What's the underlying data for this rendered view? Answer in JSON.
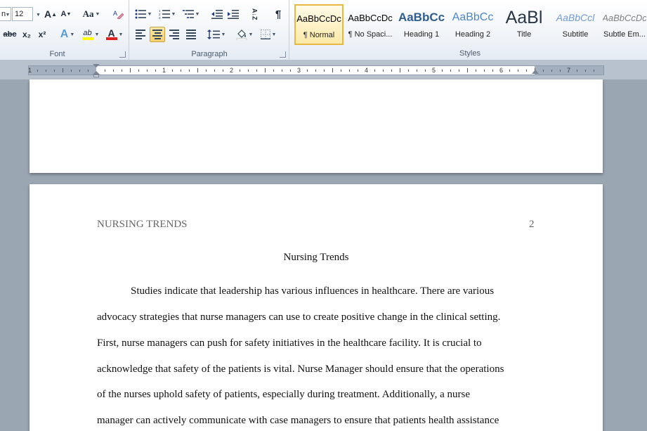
{
  "ribbon": {
    "font": {
      "label": "Font",
      "font_name": "n",
      "font_size": "12",
      "grow_icon": "A",
      "shrink_icon": "A",
      "change_case": "Aa",
      "strike": "abc",
      "subscript": "x₂",
      "superscript": "x²",
      "text_effects": "A",
      "highlight": "ab",
      "font_color": "A",
      "highlight_color": "#ffff00",
      "font_color_value": "#e02020"
    },
    "paragraph": {
      "label": "Paragraph",
      "pilcrow": "¶",
      "sort": "A↓Z"
    },
    "styles": {
      "label": "Styles",
      "items": [
        {
          "sample": "AaBbCcDc",
          "name": "¶ Normal"
        },
        {
          "sample": "AaBbCcDc",
          "name": "¶ No Spaci..."
        },
        {
          "sample": "AaBbCc",
          "name": "Heading 1"
        },
        {
          "sample": "AaBbCc",
          "name": "Heading 2"
        },
        {
          "sample": "AaBl",
          "name": "Title"
        },
        {
          "sample": "AaBbCcl",
          "name": "Subtitle"
        },
        {
          "sample": "AaBbCcDc",
          "name": "Subtle Em..."
        }
      ]
    }
  },
  "ruler": {
    "numbers": [
      "1",
      "1",
      "2",
      "3",
      "4",
      "5",
      "6",
      "7"
    ]
  },
  "document": {
    "header_text": "NURSING TRENDS",
    "page_number": "2",
    "title": "Nursing Trends",
    "lines": [
      "Studies indicate that leadership has various influences in healthcare. There are various",
      "advocacy strategies that nurse managers can use to create positive change in the clinical setting.",
      "First, nurse managers can push for safety initiatives in the healthcare facility. It is crucial to",
      "acknowledge that safety of the patients is vital. Nurse Manager should ensure that the operations",
      "of the nurses uphold safety of patients, especially during treatment. Additionally, a nurse",
      "manager can actively communicate with case managers to ensure that patients health assistance"
    ]
  }
}
